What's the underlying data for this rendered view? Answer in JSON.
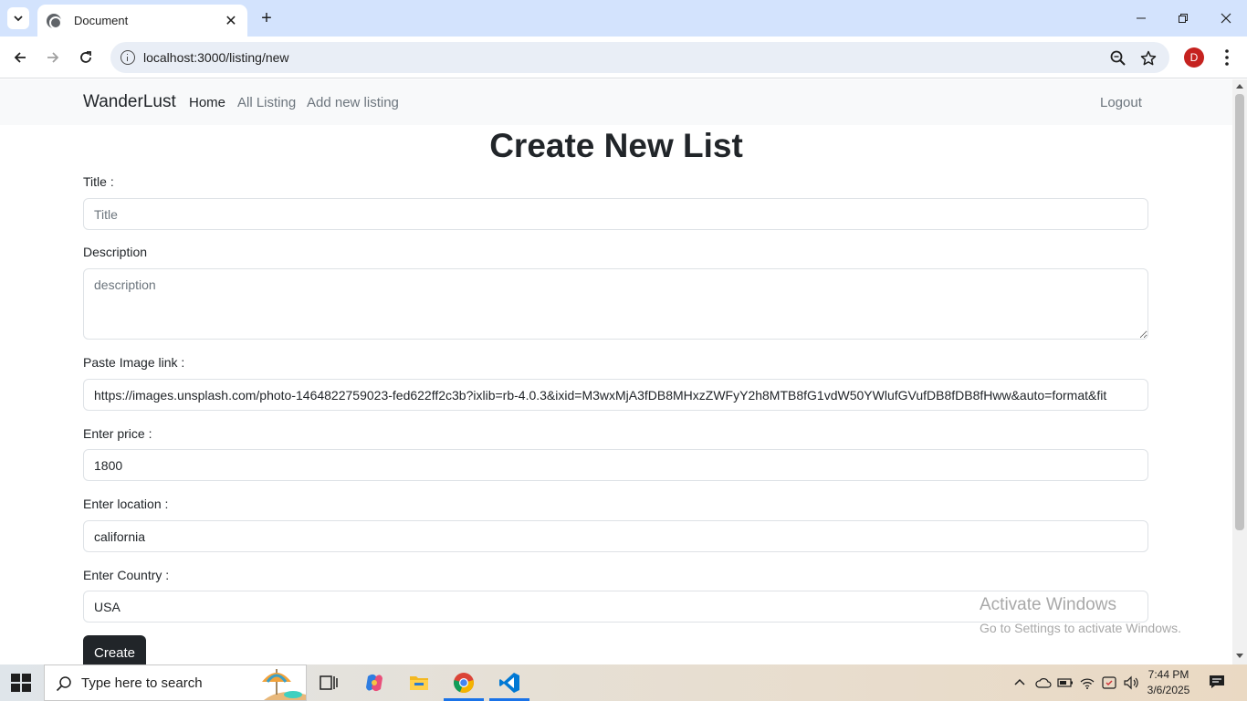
{
  "browser": {
    "tab_title": "Document",
    "url": "localhost:3000/listing/new",
    "profile_initial": "D"
  },
  "navbar": {
    "brand": "WanderLust",
    "links": [
      {
        "label": "Home"
      },
      {
        "label": "All Listing"
      },
      {
        "label": "Add new listing"
      }
    ],
    "logout": "Logout"
  },
  "form": {
    "heading": "Create New List",
    "title": {
      "label": "Title :",
      "placeholder": "Title",
      "value": ""
    },
    "description": {
      "label": "Description",
      "placeholder": "description",
      "value": ""
    },
    "image": {
      "label": "Paste Image link :",
      "value": "https://images.unsplash.com/photo-1464822759023-fed622ff2c3b?ixlib=rb-4.0.3&ixid=M3wxMjA3fDB8MHxzZWFyY2h8MTB8fG1vdW50YWlufGVufDB8fDB8fHww&auto=format&fit"
    },
    "price": {
      "label": "Enter price :",
      "value": "1800"
    },
    "location": {
      "label": "Enter location :",
      "value": "california"
    },
    "country": {
      "label": "Enter Country :",
      "value": "USA"
    },
    "submit": "Create"
  },
  "watermark": {
    "line1": "Activate Windows",
    "line2": "Go to Settings to activate Windows."
  },
  "taskbar": {
    "search_placeholder": "Type here to search",
    "time": "7:44 PM",
    "date": "3/6/2025"
  }
}
